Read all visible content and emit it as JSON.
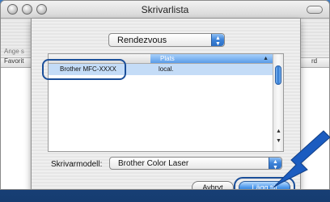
{
  "window": {
    "title": "Skrivarlista"
  },
  "background_window": {
    "left_label_1": "Ange s",
    "left_col": "Favorit",
    "right_col": "rd"
  },
  "sheet": {
    "connection_popup": {
      "selected": "Rendezvous"
    },
    "printer_list": {
      "headers": {
        "name": "",
        "location": "Plats"
      },
      "rows": [
        {
          "name": "Brother  MFC-XXXX",
          "location": "local."
        }
      ]
    },
    "printer_model": {
      "label": "Skrivarmodell:",
      "selected": "Brother Color Laser"
    },
    "buttons": {
      "cancel": "Avbryt",
      "add": "Lägg till"
    }
  },
  "colors": {
    "accent": "#3c82d8",
    "highlight_ring": "#1b4f9a",
    "selected_row": "#c4dcf7"
  }
}
